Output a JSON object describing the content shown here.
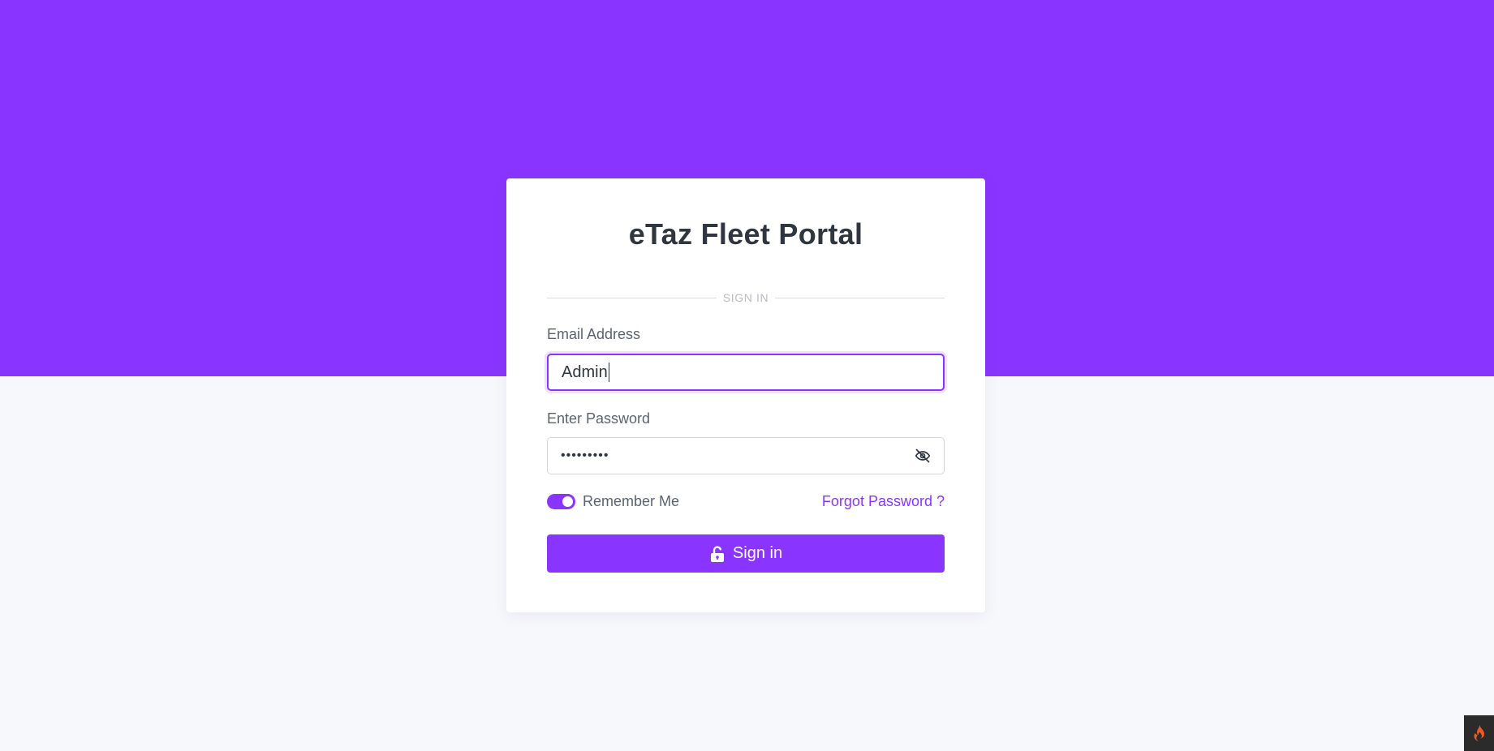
{
  "app": {
    "title": "eTaz Fleet Portal",
    "divider_text": "SIGN IN"
  },
  "form": {
    "email_label": "Email Address",
    "email_value": "Admin",
    "password_label": "Enter Password",
    "password_masked": "•••••••••",
    "remember_label": "Remember Me",
    "remember_checked": true,
    "forgot_label": "Forgot Password ?",
    "submit_label": "Sign in"
  },
  "icons": {
    "password_toggle": "eye-off-icon",
    "submit": "unlock-icon",
    "corner": "flame-icon"
  },
  "colors": {
    "accent": "#8935ff",
    "background": "#f7f8fc",
    "card": "#ffffff",
    "title_text": "#2f3640"
  }
}
